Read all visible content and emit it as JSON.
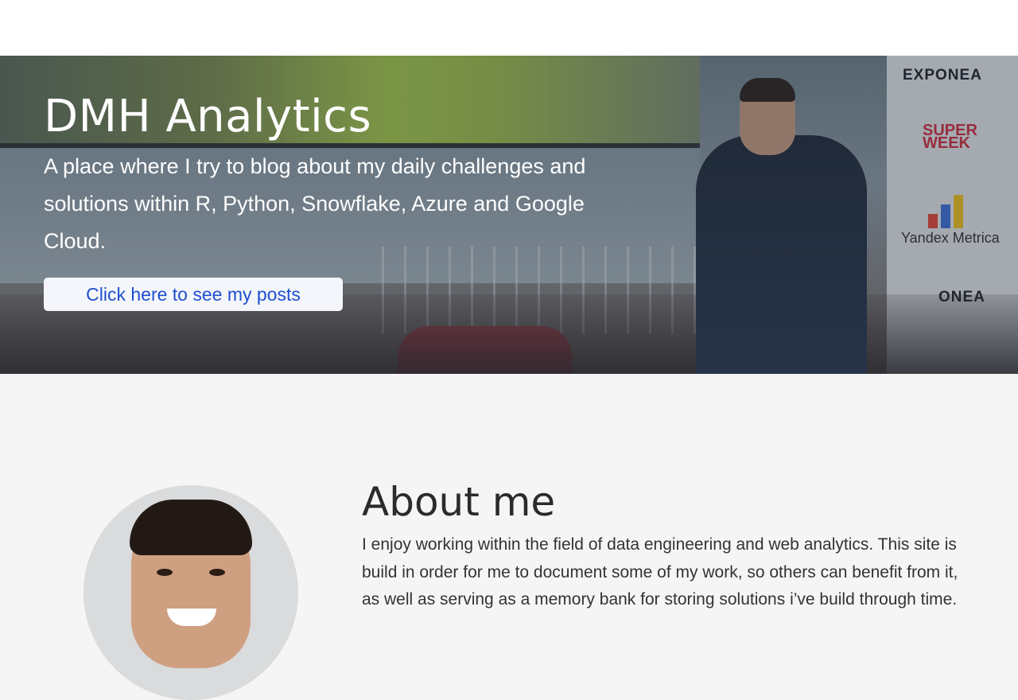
{
  "hero": {
    "title": "DMH Analytics",
    "tagline": "A place where I try to blog about my daily challenges and solutions within R, Python, Snowflake, Azure and Google Cloud.",
    "cta_label": "Click here to see my posts",
    "logos": {
      "exponea_top": "EXPONEA",
      "superweek": "SUPER WEEK",
      "yandex": "Yandex Metrica",
      "exponea_bottom": "ONEA"
    }
  },
  "about": {
    "title": "About me",
    "text": "I enjoy working within the field of data engineering and web analytics. This site is build in order for me to document some of my work, so others can benefit from it, as well as serving as a memory bank for storing solutions i’ve build through time."
  },
  "colors": {
    "cta_text": "#1e4fcf",
    "background": "#f5f5f5",
    "hero_text": "#ffffff"
  }
}
